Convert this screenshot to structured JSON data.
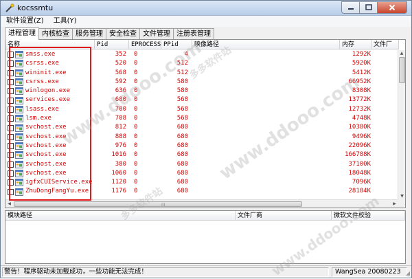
{
  "window": {
    "title": "kocssmtu"
  },
  "menubar": {
    "items": [
      "软件设置(Z)",
      "工具(Y)"
    ]
  },
  "tabs": [
    {
      "label": "进程管理",
      "active": true
    },
    {
      "label": "内核检查",
      "active": false
    },
    {
      "label": "服务管理",
      "active": false
    },
    {
      "label": "安全检查",
      "active": false
    },
    {
      "label": "文件管理",
      "active": false
    },
    {
      "label": "注册表管理",
      "active": false
    }
  ],
  "process_list": {
    "headers": [
      "名称",
      "Pid",
      "EPROCESS",
      "PPid",
      "映像路径",
      "内存",
      "文件厂"
    ],
    "rows": [
      {
        "name": "smss.exe",
        "pid": "352",
        "eprocess": "0",
        "ppid": "4",
        "path": "",
        "mem": "1292K"
      },
      {
        "name": "csrss.exe",
        "pid": "520",
        "eprocess": "0",
        "ppid": "512",
        "path": "",
        "mem": "5920K"
      },
      {
        "name": "wininit.exe",
        "pid": "568",
        "eprocess": "0",
        "ppid": "512",
        "path": "",
        "mem": "5412K"
      },
      {
        "name": "csrss.exe",
        "pid": "592",
        "eprocess": "0",
        "ppid": "580",
        "path": "",
        "mem": "66952K"
      },
      {
        "name": "winlogon.exe",
        "pid": "636",
        "eprocess": "0",
        "ppid": "580",
        "path": "",
        "mem": "8308K"
      },
      {
        "name": "services.exe",
        "pid": "680",
        "eprocess": "0",
        "ppid": "568",
        "path": "",
        "mem": "13772K"
      },
      {
        "name": "lsass.exe",
        "pid": "700",
        "eprocess": "0",
        "ppid": "568",
        "path": "",
        "mem": "12732K"
      },
      {
        "name": "lsm.exe",
        "pid": "708",
        "eprocess": "0",
        "ppid": "568",
        "path": "",
        "mem": "4748K"
      },
      {
        "name": "svchost.exe",
        "pid": "812",
        "eprocess": "0",
        "ppid": "680",
        "path": "",
        "mem": "10380K"
      },
      {
        "name": "svchost.exe",
        "pid": "888",
        "eprocess": "0",
        "ppid": "680",
        "path": "",
        "mem": "9496K"
      },
      {
        "name": "svchost.exe",
        "pid": "976",
        "eprocess": "0",
        "ppid": "680",
        "path": "",
        "mem": "22096K"
      },
      {
        "name": "svchost.exe",
        "pid": "1016",
        "eprocess": "0",
        "ppid": "680",
        "path": "",
        "mem": "166788K"
      },
      {
        "name": "svchost.exe",
        "pid": "380",
        "eprocess": "0",
        "ppid": "680",
        "path": "",
        "mem": "37100K"
      },
      {
        "name": "svchost.exe",
        "pid": "1060",
        "eprocess": "0",
        "ppid": "680",
        "path": "",
        "mem": "18048K"
      },
      {
        "name": "igfxCUIService.exe",
        "pid": "1120",
        "eprocess": "0",
        "ppid": "680",
        "path": "",
        "mem": "7096K"
      },
      {
        "name": "ZhuDongFangYu.exe",
        "pid": "1176",
        "eprocess": "0",
        "ppid": "680",
        "path": "",
        "mem": "28184K"
      }
    ],
    "grip_glyph": "III"
  },
  "module_list": {
    "headers": [
      "模块路径",
      "文件厂商",
      "微软文件校验"
    ]
  },
  "status": {
    "message": "警告！程序驱动未加载成功，一些功能无法完成！",
    "version": "WangSea 20080223"
  },
  "colors": {
    "process_text": "#d40000",
    "highlight_box": "#e01a1a",
    "title_gradient": "#c6d8ef"
  },
  "watermark": {
    "text": "www.ddooo.com",
    "text_cn": "多多软件站"
  }
}
